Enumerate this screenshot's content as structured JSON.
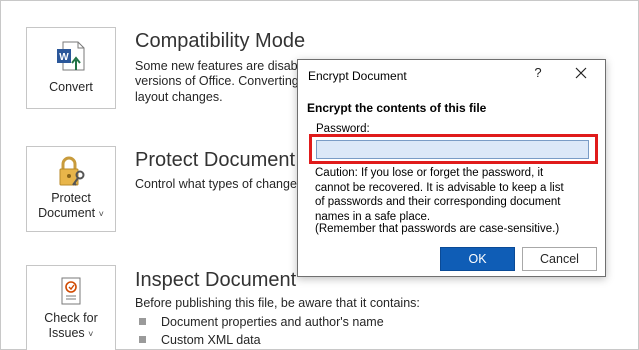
{
  "compatibility": {
    "button_label": "Convert",
    "title": "Compatibility Mode",
    "desc_lines": [
      "Some new features are disabled",
      "versions of Office. Converting t",
      "layout changes."
    ]
  },
  "protect": {
    "button_label_1": "Protect",
    "button_label_2": "Document",
    "title": "Protect Document",
    "desc": "Control what types of changes"
  },
  "inspect": {
    "button_label_1": "Check for",
    "button_label_2": "Issues",
    "title": "Inspect Document",
    "desc": "Before publishing this file, be aware that it contains:",
    "bullets": [
      "Document properties and author's name",
      "Custom XML data"
    ]
  },
  "caret": "˅",
  "dialog": {
    "title": "Encrypt Document",
    "help": "?",
    "heading": "Encrypt the contents of this file",
    "password_label": "Password:",
    "password_value": "",
    "caution": "Caution: If you lose or forget the password, it cannot be recovered. It is advisable to keep a list of passwords and their corresponding document names in a safe place.",
    "remember": "(Remember that passwords are case-sensitive.)",
    "ok_label": "OK",
    "cancel_label": "Cancel"
  },
  "colors": {
    "accent": "#0f5db6",
    "highlight": "#e01b1b",
    "input_bg": "#dce8f8"
  },
  "icons": [
    "word-convert-icon",
    "lock-key-icon",
    "checklist-icon",
    "close-icon"
  ]
}
